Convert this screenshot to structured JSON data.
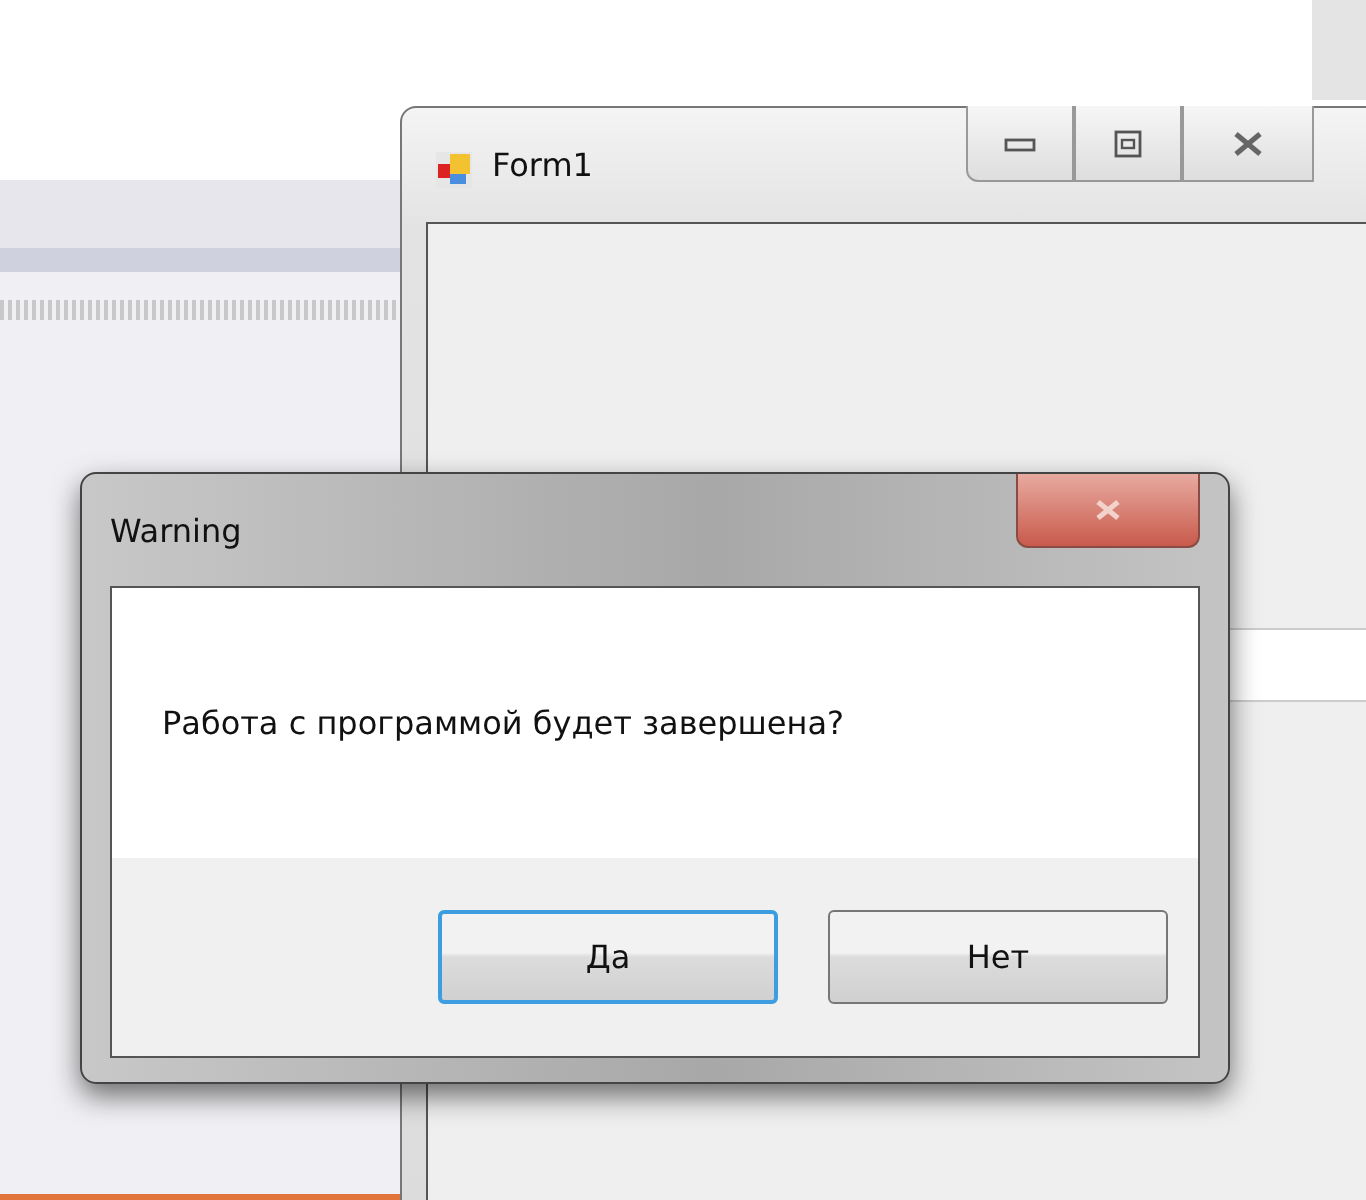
{
  "form_window": {
    "title": "Form1"
  },
  "dialog": {
    "title": "Warning",
    "message": "Работа с программой будет завершена?",
    "buttons": [
      {
        "label": "Да",
        "focused": true
      },
      {
        "label": "Нет",
        "focused": false
      }
    ]
  }
}
